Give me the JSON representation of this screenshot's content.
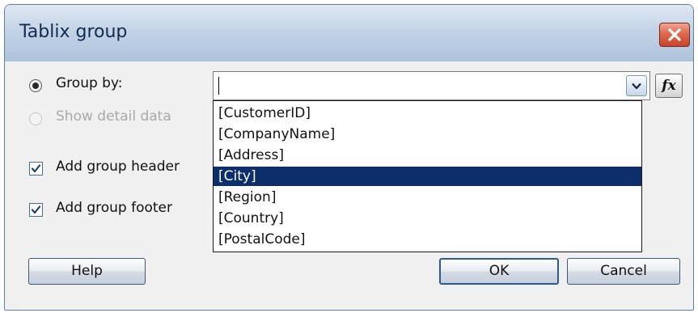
{
  "dialog": {
    "title": "Tablix group",
    "close_icon": "close-icon"
  },
  "group_by": {
    "label": "Group by:",
    "selected": true,
    "value": "",
    "expression_button_label": "fx"
  },
  "show_detail": {
    "label": "Show detail data",
    "selected": false,
    "enabled": false
  },
  "options": {
    "header_label": "Add group header",
    "header_checked": true,
    "footer_label": "Add group footer",
    "footer_checked": true
  },
  "dropdown": {
    "items": [
      "[CustomerID]",
      "[CompanyName]",
      "[Address]",
      "[City]",
      "[Region]",
      "[Country]",
      "[PostalCode]"
    ],
    "selected_item": "[City]"
  },
  "buttons": {
    "help": "Help",
    "ok": "OK",
    "cancel": "Cancel"
  },
  "colors": {
    "selection": "#0c2f6b",
    "title_text": "#142b4f",
    "close_button": "#d45a3f"
  }
}
